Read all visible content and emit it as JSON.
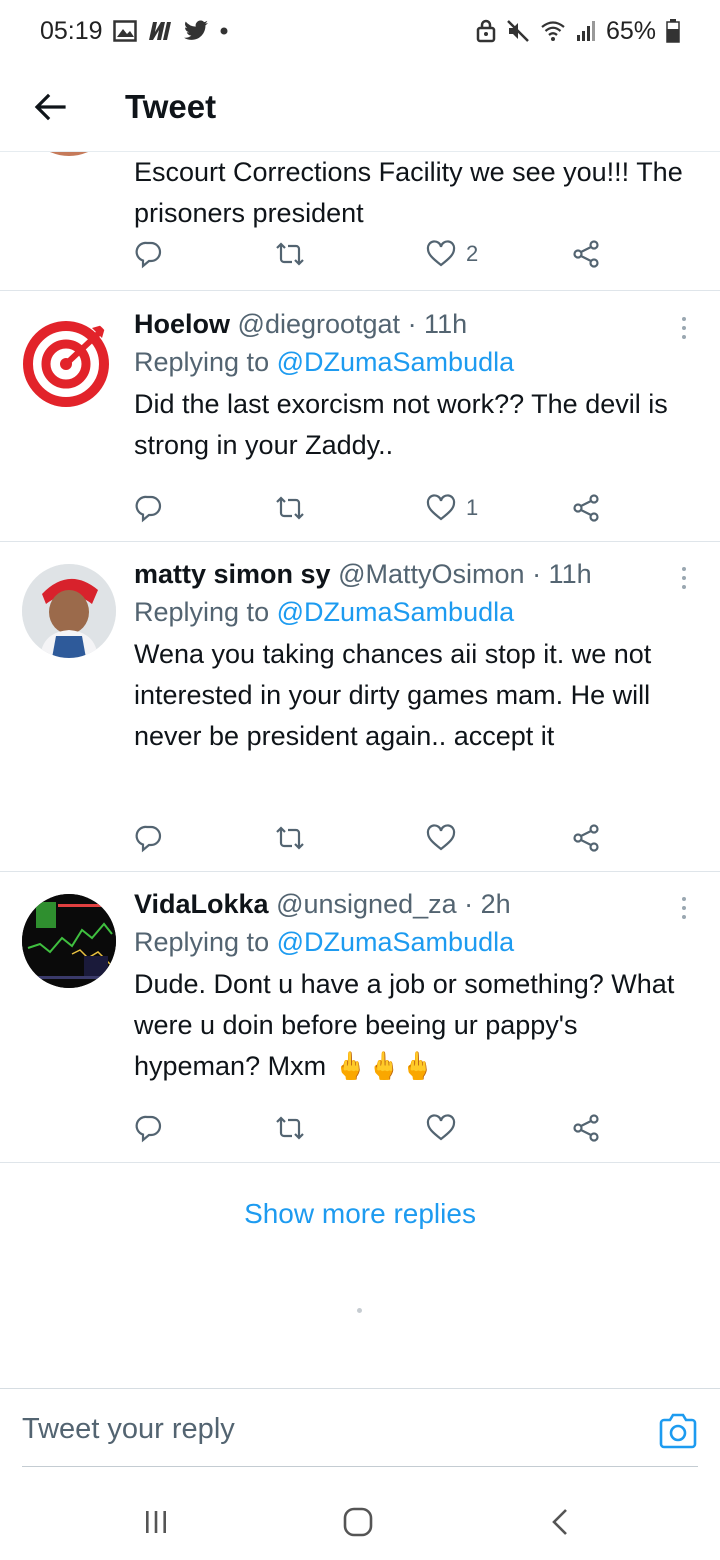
{
  "status_bar": {
    "time": "05:19",
    "battery": "65%",
    "left_icons": [
      "image-icon",
      "netflix-icon",
      "twitter-icon",
      "dot-icon"
    ],
    "right_icons": [
      "lock-icon",
      "mute-icon",
      "wifi-icon",
      "signal-icon",
      "battery-icon"
    ]
  },
  "header": {
    "title": "Tweet"
  },
  "tweets": [
    {
      "text": "Escourt Corrections Facility we see you!!! The prisoners president",
      "likes": "2"
    },
    {
      "name": "Hoelow",
      "handle": "@diegrootgat",
      "time": "· 11h",
      "replying_label": "Replying to",
      "replying_to": "@DZumaSambudla",
      "text": "Did the last exorcism not work?? The devil is strong in your Zaddy..",
      "likes": "1",
      "avatar": "target-logo"
    },
    {
      "name": "matty simon sy",
      "handle": "@MattyOsimon",
      "time": "· 11h",
      "replying_label": "Replying to",
      "replying_to": "@DZumaSambudla",
      "text": "Wena you taking chances aii stop it. we not interested in your dirty games mam. He will never be president again.. accept it",
      "likes": "",
      "avatar": "baby-photo"
    },
    {
      "name": "VidaLokka",
      "handle": "@unsigned_za",
      "time": "· 2h",
      "replying_label": "Replying to",
      "replying_to": "@DZumaSambudla",
      "text": "Dude. Dont u have a job or something? What were u doin before beeing ur pappy's hypeman? Mxm",
      "emoji": "🖕🖕🖕",
      "likes": "",
      "avatar": "trading-chart"
    }
  ],
  "show_more": "Show more replies",
  "composer": {
    "placeholder": "Tweet your reply"
  },
  "colors": {
    "accent": "#1d9bf0",
    "text": "#0f1419",
    "secondary": "#536471"
  }
}
